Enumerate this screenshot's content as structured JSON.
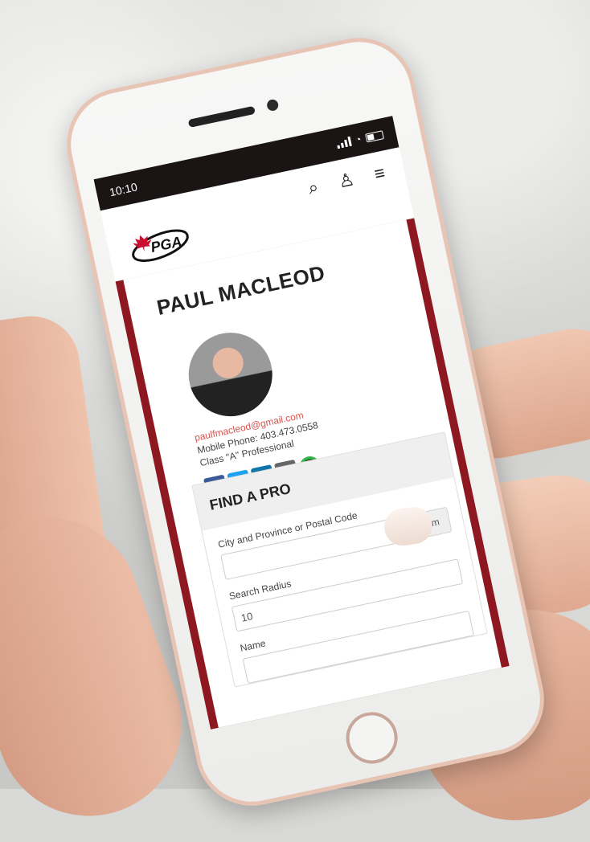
{
  "statusbar": {
    "time": "10:10"
  },
  "header": {
    "logo_text": "PGA"
  },
  "profile": {
    "name": "PAUL MACLEOD",
    "email": "paulfmacleod@gmail.com",
    "phone": "Mobile Phone: 403.473.0558",
    "class": "Class \"A\" Professional"
  },
  "social": {
    "facebook": "f",
    "twitter": "t",
    "linkedin": "in",
    "email": "✉",
    "message": "💬"
  },
  "find_a_pro": {
    "title": "FIND A PRO",
    "location_label": "City and Province or Postal Code",
    "location_value": "",
    "radius_label": "Search Radius",
    "radius_value": "10",
    "radius_unit": "km",
    "name_label": "Name"
  },
  "colors": {
    "brand_red": "#8e1820",
    "email_red": "#d9534f"
  }
}
